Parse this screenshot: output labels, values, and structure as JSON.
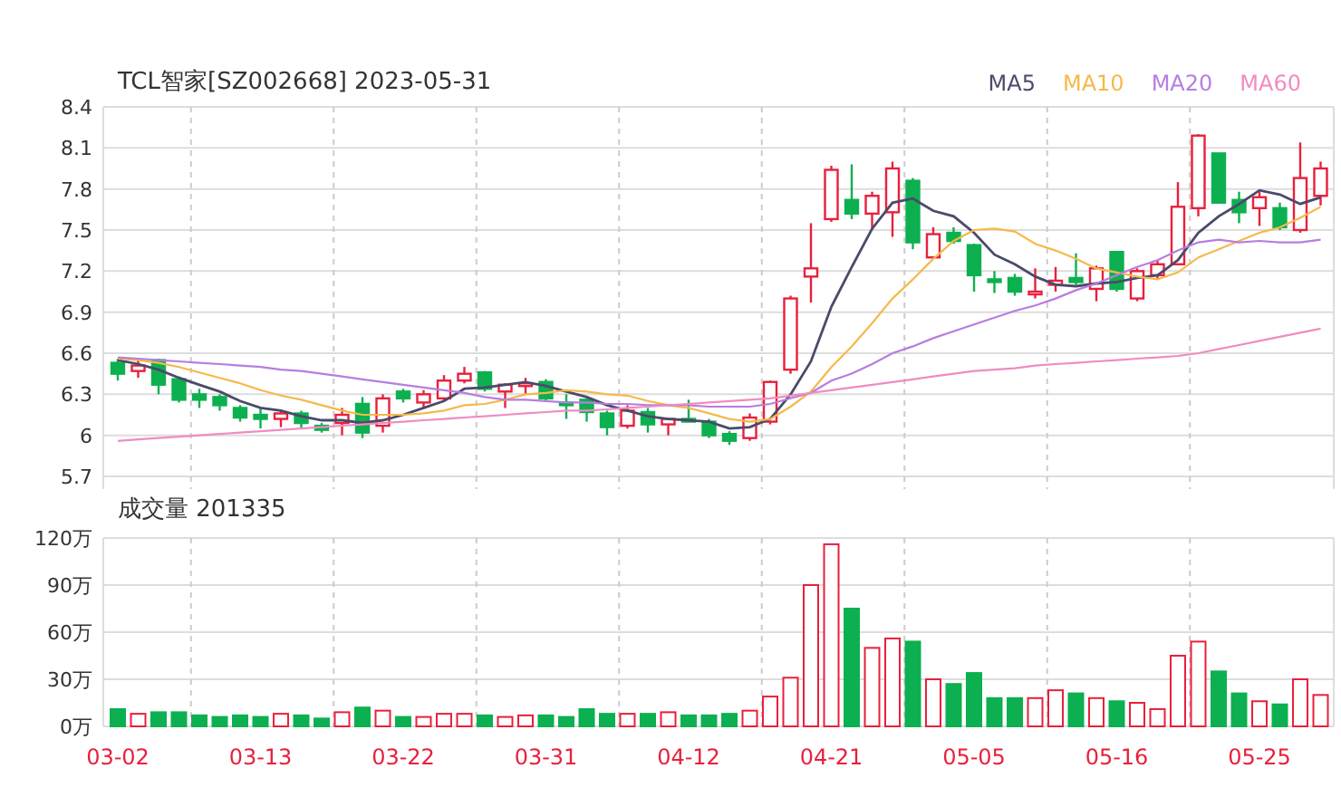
{
  "header": {
    "title": "TCL智家[SZ002668] 2023-05-31"
  },
  "price_chart": {
    "chart_data": {
      "type": "candlestick",
      "grid": true,
      "ylim": [
        5.7,
        8.4
      ],
      "yticks": [
        5.7,
        6,
        6.3,
        6.6,
        6.9,
        7.2,
        7.5,
        7.8,
        8.1,
        8.4
      ],
      "ohlc": [
        [
          6.53,
          6.56,
          6.4,
          6.45
        ],
        [
          6.47,
          6.55,
          6.42,
          6.51
        ],
        [
          6.55,
          6.56,
          6.3,
          6.37
        ],
        [
          6.41,
          6.43,
          6.24,
          6.26
        ],
        [
          6.3,
          6.34,
          6.2,
          6.26
        ],
        [
          6.28,
          6.3,
          6.18,
          6.22
        ],
        [
          6.2,
          6.22,
          6.1,
          6.13
        ],
        [
          6.15,
          6.2,
          6.05,
          6.12
        ],
        [
          6.12,
          6.18,
          6.06,
          6.16
        ],
        [
          6.16,
          6.18,
          6.05,
          6.09
        ],
        [
          6.07,
          6.09,
          6.02,
          6.04
        ],
        [
          6.09,
          6.2,
          6.0,
          6.15
        ],
        [
          6.23,
          6.28,
          5.98,
          6.02
        ],
        [
          6.07,
          6.3,
          6.02,
          6.27
        ],
        [
          6.32,
          6.34,
          6.24,
          6.27
        ],
        [
          6.24,
          6.33,
          6.2,
          6.3
        ],
        [
          6.27,
          6.44,
          6.25,
          6.4
        ],
        [
          6.4,
          6.5,
          6.38,
          6.45
        ],
        [
          6.46,
          6.47,
          6.32,
          6.34
        ],
        [
          6.32,
          6.38,
          6.2,
          6.37
        ],
        [
          6.36,
          6.42,
          6.3,
          6.38
        ],
        [
          6.39,
          6.41,
          6.25,
          6.27
        ],
        [
          6.24,
          6.3,
          6.12,
          6.22
        ],
        [
          6.26,
          6.27,
          6.1,
          6.17
        ],
        [
          6.16,
          6.18,
          6.0,
          6.06
        ],
        [
          6.07,
          6.22,
          6.05,
          6.18
        ],
        [
          6.17,
          6.2,
          6.02,
          6.08
        ],
        [
          6.08,
          6.12,
          6.0,
          6.12
        ],
        [
          6.12,
          6.26,
          6.1,
          6.11
        ],
        [
          6.1,
          6.12,
          5.98,
          6.0
        ],
        [
          6.01,
          6.03,
          5.93,
          5.96
        ],
        [
          5.98,
          6.16,
          5.96,
          6.13
        ],
        [
          6.1,
          6.4,
          6.08,
          6.39
        ],
        [
          6.48,
          7.02,
          6.45,
          7.0
        ],
        [
          7.16,
          7.55,
          6.97,
          7.22
        ],
        [
          7.58,
          7.97,
          7.56,
          7.94
        ],
        [
          7.72,
          7.98,
          7.58,
          7.62
        ],
        [
          7.62,
          7.78,
          7.5,
          7.75
        ],
        [
          7.63,
          8.0,
          7.45,
          7.95
        ],
        [
          7.86,
          7.88,
          7.36,
          7.41
        ],
        [
          7.3,
          7.52,
          7.3,
          7.47
        ],
        [
          7.48,
          7.52,
          7.4,
          7.42
        ],
        [
          7.39,
          7.4,
          7.05,
          7.17
        ],
        [
          7.14,
          7.2,
          7.04,
          7.12
        ],
        [
          7.15,
          7.18,
          7.02,
          7.05
        ],
        [
          7.04,
          7.22,
          7.0,
          7.05
        ],
        [
          7.1,
          7.23,
          7.05,
          7.13
        ],
        [
          7.15,
          7.33,
          7.1,
          7.12
        ],
        [
          7.07,
          7.24,
          6.98,
          7.22
        ],
        [
          7.34,
          7.34,
          7.05,
          7.07
        ],
        [
          7.0,
          7.22,
          6.98,
          7.2
        ],
        [
          7.17,
          7.28,
          7.14,
          7.25
        ],
        [
          7.25,
          7.85,
          7.25,
          7.67
        ],
        [
          7.66,
          8.2,
          7.6,
          8.19
        ],
        [
          8.06,
          8.06,
          7.7,
          7.7
        ],
        [
          7.72,
          7.78,
          7.55,
          7.63
        ],
        [
          7.66,
          7.78,
          7.53,
          7.74
        ],
        [
          7.66,
          7.7,
          7.5,
          7.52
        ],
        [
          7.5,
          8.14,
          7.48,
          7.88
        ],
        [
          7.75,
          8.0,
          7.68,
          7.95
        ]
      ],
      "series": [
        {
          "name": "MA5",
          "type": "line",
          "color": "#4b4a6b",
          "values": [
            6.55,
            6.52,
            6.48,
            6.42,
            6.37,
            6.32,
            6.25,
            6.2,
            6.18,
            6.14,
            6.11,
            6.11,
            6.09,
            6.11,
            6.15,
            6.2,
            6.25,
            6.34,
            6.35,
            6.37,
            6.39,
            6.36,
            6.32,
            6.28,
            6.22,
            6.18,
            6.14,
            6.12,
            6.11,
            6.1,
            6.05,
            6.06,
            6.12,
            6.3,
            6.54,
            6.94,
            7.23,
            7.51,
            7.7,
            7.73,
            7.64,
            7.6,
            7.48,
            7.32,
            7.25,
            7.16,
            7.1,
            7.09,
            7.11,
            7.12,
            7.15,
            7.17,
            7.28,
            7.48,
            7.6,
            7.69,
            7.79,
            7.76,
            7.69,
            7.74
          ]
        },
        {
          "name": "MA10",
          "type": "line",
          "color": "#f5b94a",
          "values": [
            6.56,
            6.55,
            6.53,
            6.5,
            6.46,
            6.42,
            6.38,
            6.33,
            6.29,
            6.26,
            6.22,
            6.18,
            6.15,
            6.15,
            6.15,
            6.16,
            6.18,
            6.22,
            6.23,
            6.26,
            6.3,
            6.31,
            6.33,
            6.32,
            6.3,
            6.29,
            6.25,
            6.22,
            6.2,
            6.16,
            6.12,
            6.1,
            6.12,
            6.21,
            6.32,
            6.5,
            6.65,
            6.82,
            7.0,
            7.14,
            7.29,
            7.42,
            7.5,
            7.51,
            7.49,
            7.4,
            7.35,
            7.29,
            7.22,
            7.19,
            7.16,
            7.14,
            7.19,
            7.3,
            7.36,
            7.42,
            7.48,
            7.52,
            7.59,
            7.67
          ]
        },
        {
          "name": "MA20",
          "type": "line",
          "color": "#b67ee0",
          "values": [
            6.57,
            6.56,
            6.55,
            6.54,
            6.53,
            6.52,
            6.51,
            6.5,
            6.48,
            6.47,
            6.45,
            6.43,
            6.41,
            6.39,
            6.37,
            6.35,
            6.33,
            6.31,
            6.28,
            6.26,
            6.26,
            6.25,
            6.24,
            6.24,
            6.23,
            6.23,
            6.22,
            6.22,
            6.22,
            6.21,
            6.21,
            6.21,
            6.23,
            6.27,
            6.31,
            6.4,
            6.45,
            6.52,
            6.6,
            6.65,
            6.71,
            6.76,
            6.81,
            6.86,
            6.91,
            6.95,
            7.0,
            7.06,
            7.11,
            7.17,
            7.23,
            7.28,
            7.35,
            7.41,
            7.43,
            7.41,
            7.42,
            7.41,
            7.41,
            7.43
          ]
        },
        {
          "name": "MA60",
          "type": "line",
          "color": "#f08cc0",
          "values": [
            5.96,
            5.97,
            5.98,
            5.99,
            6.0,
            6.01,
            6.02,
            6.03,
            6.04,
            6.05,
            6.06,
            6.07,
            6.08,
            6.09,
            6.1,
            6.11,
            6.12,
            6.13,
            6.14,
            6.15,
            6.16,
            6.17,
            6.18,
            6.18,
            6.19,
            6.2,
            6.21,
            6.22,
            6.23,
            6.24,
            6.25,
            6.26,
            6.27,
            6.29,
            6.31,
            6.33,
            6.35,
            6.37,
            6.39,
            6.41,
            6.43,
            6.45,
            6.47,
            6.48,
            6.49,
            6.51,
            6.52,
            6.53,
            6.54,
            6.55,
            6.56,
            6.57,
            6.58,
            6.6,
            6.63,
            6.66,
            6.69,
            6.72,
            6.75,
            6.78
          ]
        }
      ]
    }
  },
  "volume_chart": {
    "title": "成交量 201335",
    "chart_data": {
      "type": "bar",
      "grid": true,
      "categories": [
        "03-02",
        null,
        null,
        null,
        null,
        null,
        null,
        "03-13",
        null,
        null,
        null,
        null,
        null,
        null,
        "03-22",
        null,
        null,
        null,
        null,
        null,
        null,
        "03-31",
        null,
        null,
        null,
        null,
        null,
        null,
        "04-12",
        null,
        null,
        null,
        null,
        null,
        null,
        "04-21",
        null,
        null,
        null,
        null,
        null,
        null,
        "05-05",
        null,
        null,
        null,
        null,
        null,
        null,
        "05-16",
        null,
        null,
        null,
        null,
        null,
        null,
        "05-25",
        null,
        null,
        null
      ],
      "ylim": [
        0,
        120
      ],
      "yticks": [
        {
          "value": 0,
          "label": "0万"
        },
        {
          "value": 30,
          "label": "30万"
        },
        {
          "value": 60,
          "label": "60万"
        },
        {
          "value": 90,
          "label": "90万"
        },
        {
          "value": 120,
          "label": "120万"
        }
      ],
      "values": [
        11,
        8,
        9,
        9,
        7,
        6,
        7,
        6,
        8,
        7,
        5,
        9,
        12,
        10,
        6,
        6,
        8,
        8,
        7,
        6,
        7,
        7,
        6,
        11,
        8,
        8,
        8,
        9,
        7,
        7,
        8,
        10,
        19,
        31,
        90,
        116,
        75,
        50,
        56,
        54,
        30,
        27,
        34,
        18,
        18,
        18,
        23,
        21,
        18,
        16,
        15,
        11,
        45,
        54,
        35,
        21,
        16,
        14,
        30,
        20
      ]
    }
  }
}
